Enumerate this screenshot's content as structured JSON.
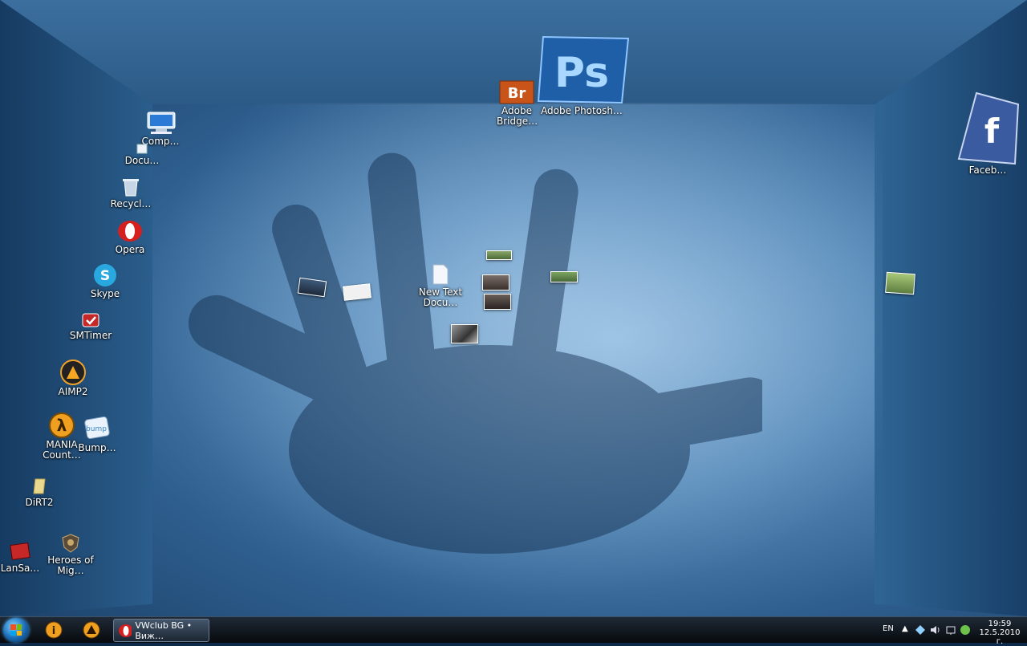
{
  "desktop_icons": [
    {
      "label": "Comp…",
      "icon": "computer-icon"
    },
    {
      "label": "Docu…",
      "icon": "documents-icon"
    },
    {
      "label": "Recycl…",
      "icon": "recycle-bin-icon"
    },
    {
      "label": "Opera",
      "icon": "opera-icon"
    },
    {
      "label": "Skype",
      "icon": "skype-icon"
    },
    {
      "label": "SMTimer",
      "icon": "smtimer-icon"
    },
    {
      "label": "AIMP2",
      "icon": "aimp-icon"
    },
    {
      "label": "MANIA Count…",
      "icon": "half-life-icon"
    },
    {
      "label": "Bump…",
      "icon": "bumptop-icon"
    },
    {
      "label": "DiRT2",
      "icon": "dirt2-icon"
    },
    {
      "label": "LanSa…",
      "icon": "lansa-icon"
    },
    {
      "label": "Heroes of Mig…",
      "icon": "heroes-icon"
    },
    {
      "label": "Adobe Bridge…",
      "icon": "bridge-icon",
      "glyph_text": "Br"
    },
    {
      "label": "Adobe Photosh…",
      "icon": "photoshop-icon",
      "glyph_text": "Ps"
    },
    {
      "label": "Faceb…",
      "icon": "facebook-icon",
      "glyph_text": "f"
    },
    {
      "label": "New Text Docu…",
      "icon": "text-document-icon"
    }
  ],
  "taskbar": {
    "active_task_label": "VWclub BG • Виж…",
    "language": "EN",
    "clock_time": "19:59",
    "clock_date": "12.5.2010 г."
  },
  "colors": {
    "photoshop": "#2d7bd0",
    "bridge": "#c9541a",
    "opera": "#d61f1f",
    "skype": "#29a8e0",
    "facebook": "#3b5ba0"
  }
}
